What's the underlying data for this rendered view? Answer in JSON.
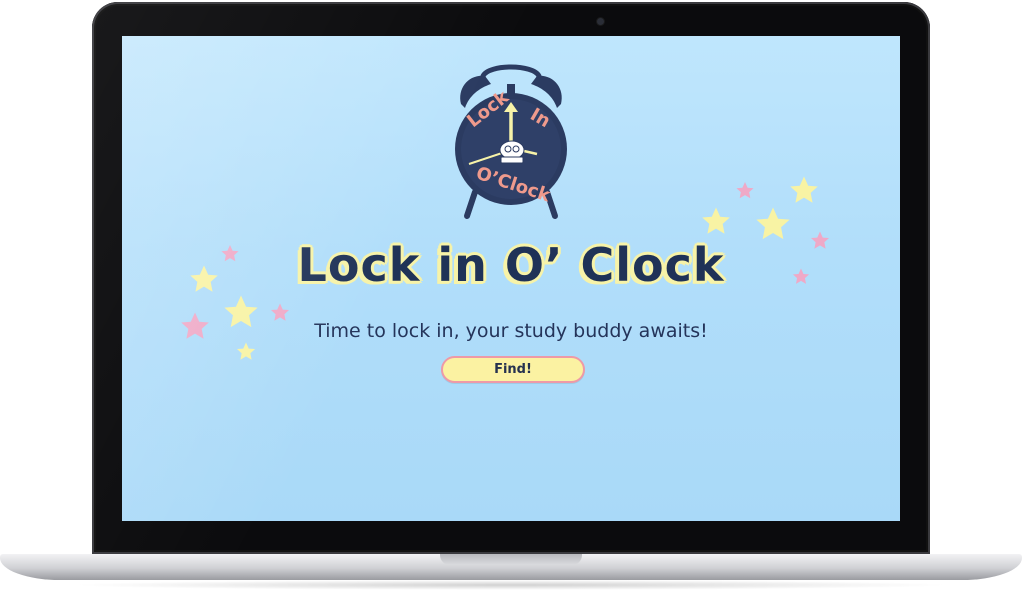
{
  "app": {
    "title": "Lock in O’ Clock",
    "tagline": "Time to lock in, your study buddy awaits!",
    "find_button_label": "Find!"
  },
  "logo": {
    "line1": "Lock",
    "line2": "In",
    "line3": "O’Clock"
  },
  "colors": {
    "background": "#b1defa",
    "title_fill": "#1f3257",
    "title_outline": "#f7f3a8",
    "button_fill": "#fbf2a2",
    "button_border": "#ee9aa7",
    "logo_body": "#2b3b61",
    "logo_lettering": "#ef9a8c",
    "star_yellow": "#f8f3a4",
    "star_pink": "#efa9c7"
  },
  "icons": {
    "logo": "alarm-clock-logo",
    "decoration": "star-icon"
  }
}
